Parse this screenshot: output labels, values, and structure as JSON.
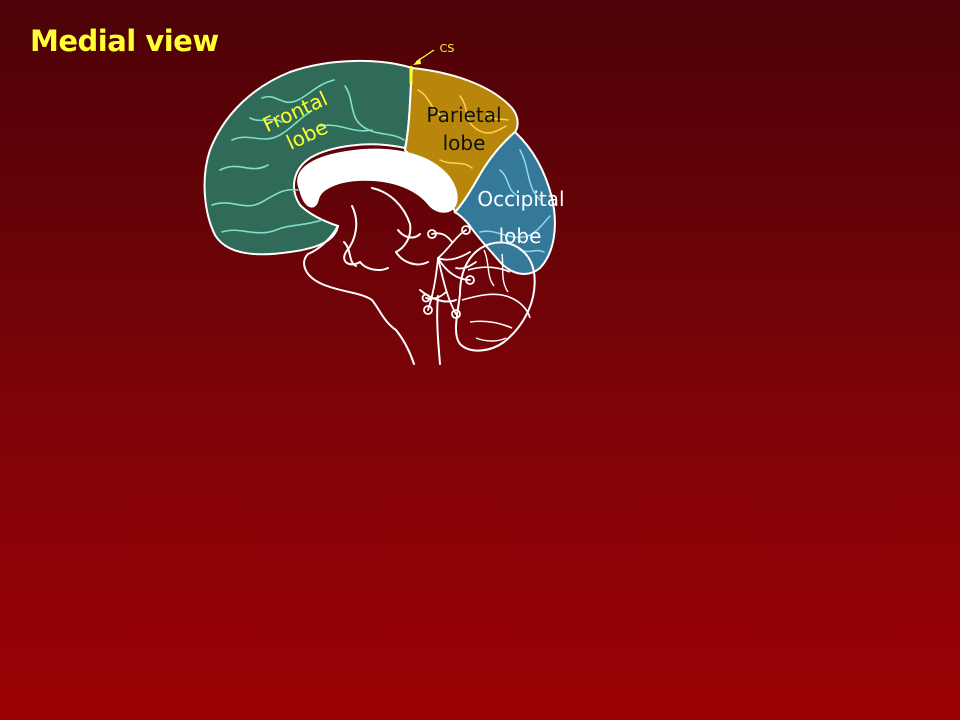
{
  "slide": {
    "title": "Medial view"
  },
  "labels": {
    "cs": "CS",
    "frontal_line1": "Frontal",
    "frontal_line2": "lobe",
    "parietal_line1": "Parietal",
    "parietal_line2": "lobe",
    "occipital_line1": "Occipital",
    "occipital_line2": "lobe"
  },
  "colors": {
    "background_top": "#4c0207",
    "background_bottom": "#9c0205",
    "title": "#ffff33",
    "frontal_fill": "#2f6b58",
    "frontal_sulci": "#7fe0c4",
    "parietal_fill": "#b8860b",
    "parietal_sulci": "#ffd34d",
    "occipital_fill": "#35799a",
    "occipital_sulci": "#8fd8f0",
    "outline": "#ffffff"
  }
}
